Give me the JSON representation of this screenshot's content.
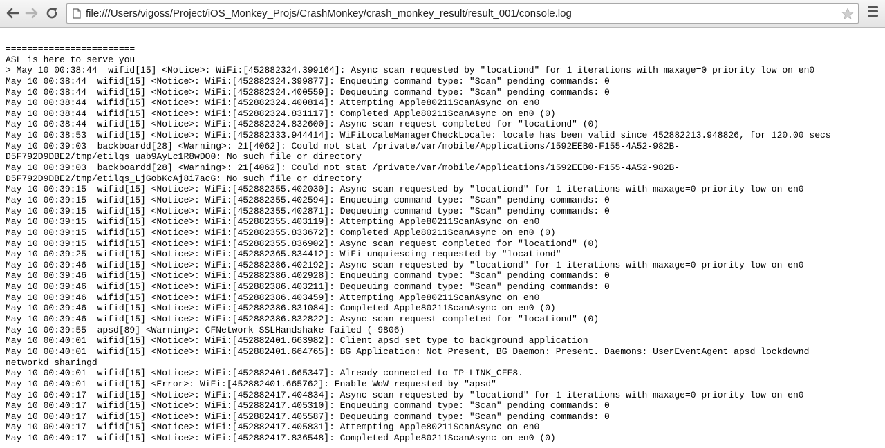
{
  "browser": {
    "url": "file:///Users/vigoss/Project/iOS_Monkey_Projs/CrashMonkey/crash_monkey_result/result_001/console.log",
    "icons": [
      "back-arrow-icon",
      "forward-arrow-icon",
      "reload-icon",
      "page-icon",
      "star-icon",
      "menu-icon"
    ]
  },
  "console": {
    "lines": [
      "========================",
      "ASL is here to serve you",
      "> May 10 00:38:44  wifid[15] <Notice>: WiFi:[452882324.399164]: Async scan requested by \"locationd\" for 1 iterations with maxage=0 priority low on en0",
      "May 10 00:38:44  wifid[15] <Notice>: WiFi:[452882324.399877]: Enqueuing command type: \"Scan\" pending commands: 0",
      "May 10 00:38:44  wifid[15] <Notice>: WiFi:[452882324.400559]: Dequeuing command type: \"Scan\" pending commands: 0",
      "May 10 00:38:44  wifid[15] <Notice>: WiFi:[452882324.400814]: Attempting Apple80211ScanAsync on en0",
      "May 10 00:38:44  wifid[15] <Notice>: WiFi:[452882324.831117]: Completed Apple80211ScanAsync on en0 (0)",
      "May 10 00:38:44  wifid[15] <Notice>: WiFi:[452882324.832600]: Async scan request completed for \"locationd\" (0)",
      "May 10 00:38:53  wifid[15] <Notice>: WiFi:[452882333.944414]: WiFiLocaleManagerCheckLocale: locale has been valid since 452882213.948826, for 120.00 secs",
      "May 10 00:39:03  backboardd[28] <Warning>: 21[4062]: Could not stat /private/var/mobile/Applications/1592EEB0-F155-4A52-982B-",
      "D5F792D9DBE2/tmp/etilqs_uab9AyLc1R8wDO0: No such file or directory",
      "May 10 00:39:03  backboardd[28] <Warning>: 21[4062]: Could not stat /private/var/mobile/Applications/1592EEB0-F155-4A52-982B-",
      "D5F792D9DBE2/tmp/etilqs_LjGobKcAj8i7acG: No such file or directory",
      "May 10 00:39:15  wifid[15] <Notice>: WiFi:[452882355.402030]: Async scan requested by \"locationd\" for 1 iterations with maxage=0 priority low on en0",
      "May 10 00:39:15  wifid[15] <Notice>: WiFi:[452882355.402594]: Enqueuing command type: \"Scan\" pending commands: 0",
      "May 10 00:39:15  wifid[15] <Notice>: WiFi:[452882355.402871]: Dequeuing command type: \"Scan\" pending commands: 0",
      "May 10 00:39:15  wifid[15] <Notice>: WiFi:[452882355.403119]: Attempting Apple80211ScanAsync on en0",
      "May 10 00:39:15  wifid[15] <Notice>: WiFi:[452882355.833672]: Completed Apple80211ScanAsync on en0 (0)",
      "May 10 00:39:15  wifid[15] <Notice>: WiFi:[452882355.836902]: Async scan request completed for \"locationd\" (0)",
      "May 10 00:39:25  wifid[15] <Notice>: WiFi:[452882365.834412]: WiFi unquiescing requested by \"locationd\"",
      "May 10 00:39:46  wifid[15] <Notice>: WiFi:[452882386.402192]: Async scan requested by \"locationd\" for 1 iterations with maxage=0 priority low on en0",
      "May 10 00:39:46  wifid[15] <Notice>: WiFi:[452882386.402928]: Enqueuing command type: \"Scan\" pending commands: 0",
      "May 10 00:39:46  wifid[15] <Notice>: WiFi:[452882386.403211]: Dequeuing command type: \"Scan\" pending commands: 0",
      "May 10 00:39:46  wifid[15] <Notice>: WiFi:[452882386.403459]: Attempting Apple80211ScanAsync on en0",
      "May 10 00:39:46  wifid[15] <Notice>: WiFi:[452882386.831084]: Completed Apple80211ScanAsync on en0 (0)",
      "May 10 00:39:46  wifid[15] <Notice>: WiFi:[452882386.832822]: Async scan request completed for \"locationd\" (0)",
      "May 10 00:39:55  apsd[89] <Warning>: CFNetwork SSLHandshake failed (-9806)",
      "May 10 00:40:01  wifid[15] <Notice>: WiFi:[452882401.663982]: Client apsd set type to background application",
      "May 10 00:40:01  wifid[15] <Notice>: WiFi:[452882401.664765]: BG Application: Not Present, BG Daemon: Present. Daemons: UserEventAgent apsd lockdownd",
      "networkd sharingd",
      "May 10 00:40:01  wifid[15] <Notice>: WiFi:[452882401.665347]: Already connected to TP-LINK_CFF8.",
      "May 10 00:40:01  wifid[15] <Error>: WiFi:[452882401.665762]: Enable WoW requested by \"apsd\"",
      "May 10 00:40:17  wifid[15] <Notice>: WiFi:[452882417.404834]: Async scan requested by \"locationd\" for 1 iterations with maxage=0 priority low on en0",
      "May 10 00:40:17  wifid[15] <Notice>: WiFi:[452882417.405310]: Enqueuing command type: \"Scan\" pending commands: 0",
      "May 10 00:40:17  wifid[15] <Notice>: WiFi:[452882417.405587]: Dequeuing command type: \"Scan\" pending commands: 0",
      "May 10 00:40:17  wifid[15] <Notice>: WiFi:[452882417.405831]: Attempting Apple80211ScanAsync on en0",
      "May 10 00:40:17  wifid[15] <Notice>: WiFi:[452882417.836548]: Completed Apple80211ScanAsync on en0 (0)"
    ]
  }
}
